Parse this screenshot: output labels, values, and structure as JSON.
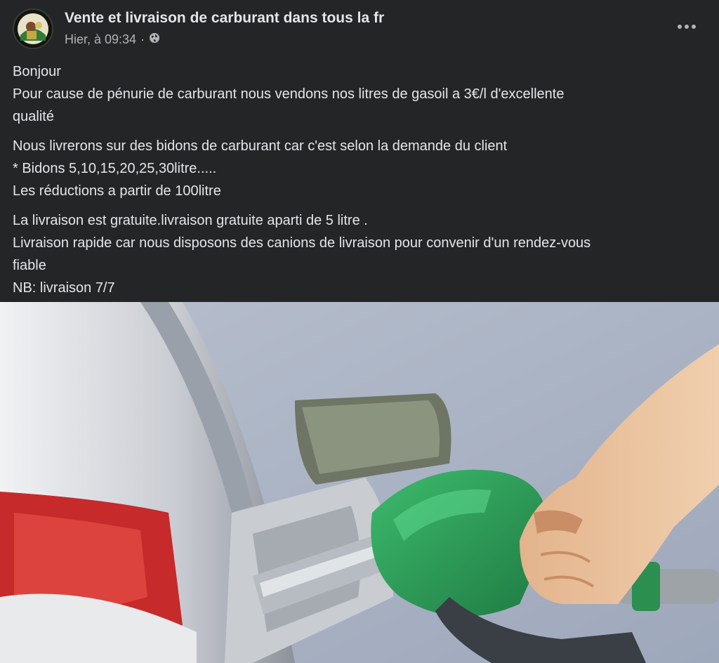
{
  "post": {
    "author": "Vente et livraison de carburant dans tous la fr",
    "timestamp": "Hier, à 09:34",
    "separator": "·",
    "privacy_icon": "globe-icon",
    "more_icon": "more-options-icon",
    "paragraphs": [
      [
        "Bonjour",
        "Pour cause de pénurie de carburant nous vendons nos litres de gasoil a 3€/l d'excellente",
        "qualité"
      ],
      [
        "Nous livrerons sur des bidons de carburant car c'est selon la demande du client",
        "* Bidons 5,10,15,20,25,30litre.....",
        "Les réductions a partir de 100litre"
      ],
      [
        "La livraison est gratuite.livraison gratuite aparti de 5 litre .",
        "Livraison rapide car nous disposons des canions de livraison pour convenir d'un rendez-vous",
        "fiable",
        "NB: livraison 7/7"
      ]
    ]
  },
  "colors": {
    "background": "#242526",
    "text": "#e4e6eb",
    "secondary_text": "#b0b3b8",
    "nozzle_green": "#2e9a57"
  }
}
